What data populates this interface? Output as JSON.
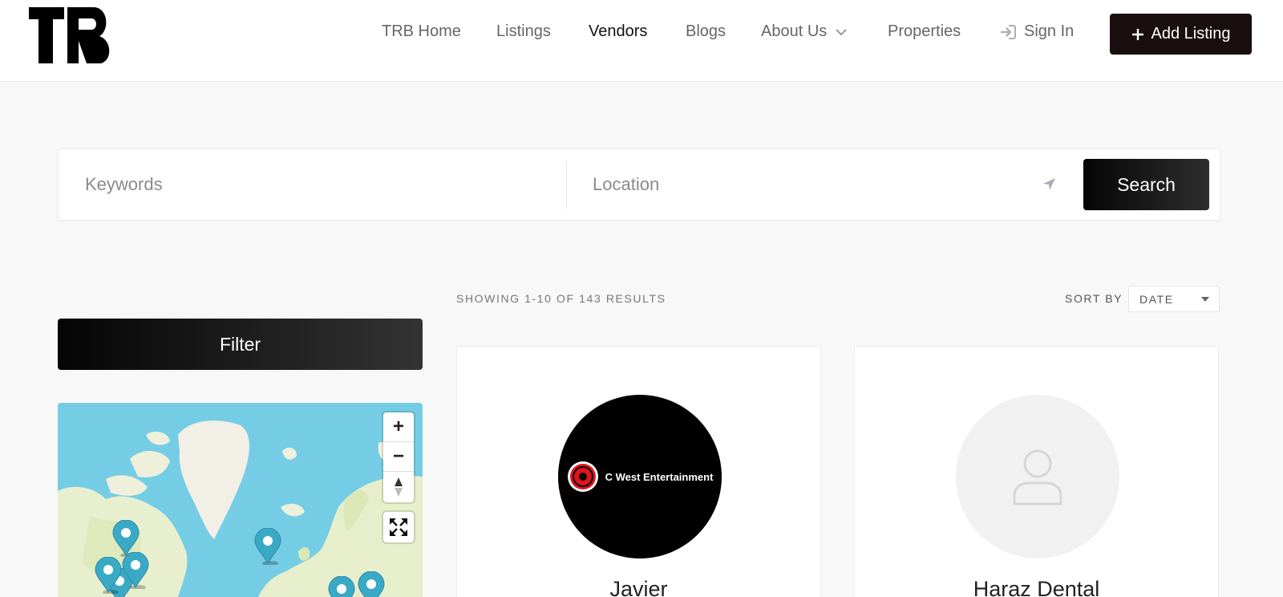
{
  "header": {
    "logo_text": "TRB",
    "nav": [
      {
        "label": "TRB Home"
      },
      {
        "label": "Listings"
      },
      {
        "label": "Vendors"
      },
      {
        "label": "Blogs"
      },
      {
        "label": "About Us"
      },
      {
        "label": "Properties"
      },
      {
        "label": "Sign In"
      }
    ],
    "add_listing_label": "Add Listing"
  },
  "search": {
    "keywords_placeholder": "Keywords",
    "keywords_value": "",
    "location_placeholder": "Location",
    "location_value": "",
    "button_label": "Search"
  },
  "results": {
    "showing_text": "SHOWING 1-10 OF 143 RESULTS",
    "sort_label": "SORT BY",
    "sort_value": "DATE"
  },
  "filter": {
    "button_label": "Filter"
  },
  "map": {
    "zoom_in": "+",
    "zoom_out": "−",
    "pin_color": "#3aa9c6"
  },
  "cards": [
    {
      "title": "Javier",
      "logo_text": "C West Entertainment"
    },
    {
      "title": "Haraz Dental"
    }
  ],
  "colors": {
    "accent": "#1a0f0f",
    "map_water": "#74cde4",
    "map_land": "#f2efe6"
  }
}
